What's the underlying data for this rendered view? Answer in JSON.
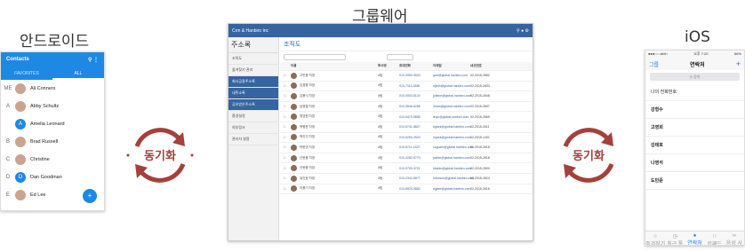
{
  "titles": {
    "android": "안드로이드",
    "groupware": "그룹웨어",
    "ios": "iOS"
  },
  "sync_label": "동기화",
  "colors": {
    "android_blue": "#1e88e5",
    "groupware_blue": "#35649f",
    "sync_red": "#a5403a",
    "ios_blue": "#1a7df0"
  },
  "android": {
    "title": "Contacts",
    "tabs": [
      "FAVORITES",
      "ALL"
    ],
    "contacts": [
      {
        "letter": "ME",
        "name": "Ali Conners",
        "avatar": ""
      },
      {
        "letter": "A",
        "name": "Abby Schultz",
        "avatar": ""
      },
      {
        "letter": "",
        "name": "Amelia Leonard",
        "avatar": "A"
      },
      {
        "letter": "B",
        "name": "Brad Russell",
        "avatar": ""
      },
      {
        "letter": "C",
        "name": "Christine",
        "avatar": ""
      },
      {
        "letter": "D",
        "name": "Dan Goodman",
        "avatar": "D"
      },
      {
        "letter": "E",
        "name": "Ed Lee",
        "avatar": ""
      }
    ]
  },
  "groupware": {
    "brand": "Crm & Hanbiro Inc",
    "section": "주소록",
    "page_title": "조직도",
    "sidebar": [
      "조직도",
      "즐겨찾기 관리",
      "회사공용주소록",
      "내주소록",
      "공유받은주소록",
      "환경설정",
      "외부링크",
      "관리자 설정"
    ],
    "columns": [
      "이름",
      "부서명",
      "휴대전화",
      "이메일",
      "내선번호"
    ],
    "rows": [
      {
        "name": "고민용 차장",
        "dept": "4팀",
        "phone": "010-3950-3520",
        "email": "gotr@global.hanbiro.com",
        "ext": "02-2015-2652"
      },
      {
        "name": "김경환 차장",
        "dept": "4팀",
        "phone": "010-7110-3480",
        "email": "djbrth@global.hanbiro.com",
        "ext": "02-2015-2633"
      },
      {
        "name": "김용식 차장",
        "dept": "4팀",
        "phone": "010-0003-5124",
        "email": "jobkim@global.hanbiro.com",
        "ext": "02-2015-2648"
      },
      {
        "name": "남정철 차장",
        "dept": "4팀",
        "phone": "010-3546-6266",
        "email": "3man@global.hanbiro.com",
        "ext": "02-2015-2697"
      },
      {
        "name": "류영원 차장",
        "dept": "4팀",
        "phone": "010-5470-5856",
        "email": "linyu@global.hanbiro.com",
        "ext": "02-2015-2669"
      },
      {
        "name": "박병준 차장",
        "dept": "4팀",
        "phone": "010-5741-8827",
        "email": "bjpark@global.hanbiro.com",
        "ext": "02-2015-2611"
      },
      {
        "name": "박인선 차장",
        "dept": "4팀",
        "phone": "010-6260-2520",
        "email": "inpark@global.hanbiro.com",
        "ext": "02-2015-1401"
      },
      {
        "name": "박한영 차장",
        "dept": "4팀",
        "phone": "010-5711-1527",
        "email": "coypark@global.hanbiro.com",
        "ext": "02-2015-2618"
      },
      {
        "name": "신현중 차장",
        "dept": "4팀",
        "phone": "010-4282-9770",
        "email": "joshin@global.hanbiro.com",
        "ext": "02-2015-2618"
      },
      {
        "name": "신현중 차장",
        "dept": "4팀",
        "phone": "010-9700-3721",
        "email": "hkshin@global.hanbiro.com",
        "ext": "02-2015-2690"
      },
      {
        "name": "유인호 차장",
        "dept": "4팀",
        "phone": "010-2342-6877",
        "email": "inhowoo@global.hanbiro.com",
        "ext": "02-2015-2624"
      },
      {
        "name": "이용기 차장",
        "dept": "4팀",
        "phone": "010-8920-9852",
        "email": "ejglee@global.hanbiro.com",
        "ext": "02-2015-2616"
      }
    ]
  },
  "ios": {
    "status_left": "●●●○○ olleh",
    "status_time": "오후 7:20",
    "status_right": "66%",
    "back": "그룹",
    "title": "연락처",
    "add": "+",
    "search": "검색",
    "my_number": "나의 전화번호:",
    "contacts": [
      "강형수",
      "고영희",
      "김태호",
      "나영석",
      "도민준"
    ],
    "tabs": [
      "즐겨찾기",
      "최근 통화",
      "연락처",
      "키패드",
      "음성 사서함"
    ]
  }
}
